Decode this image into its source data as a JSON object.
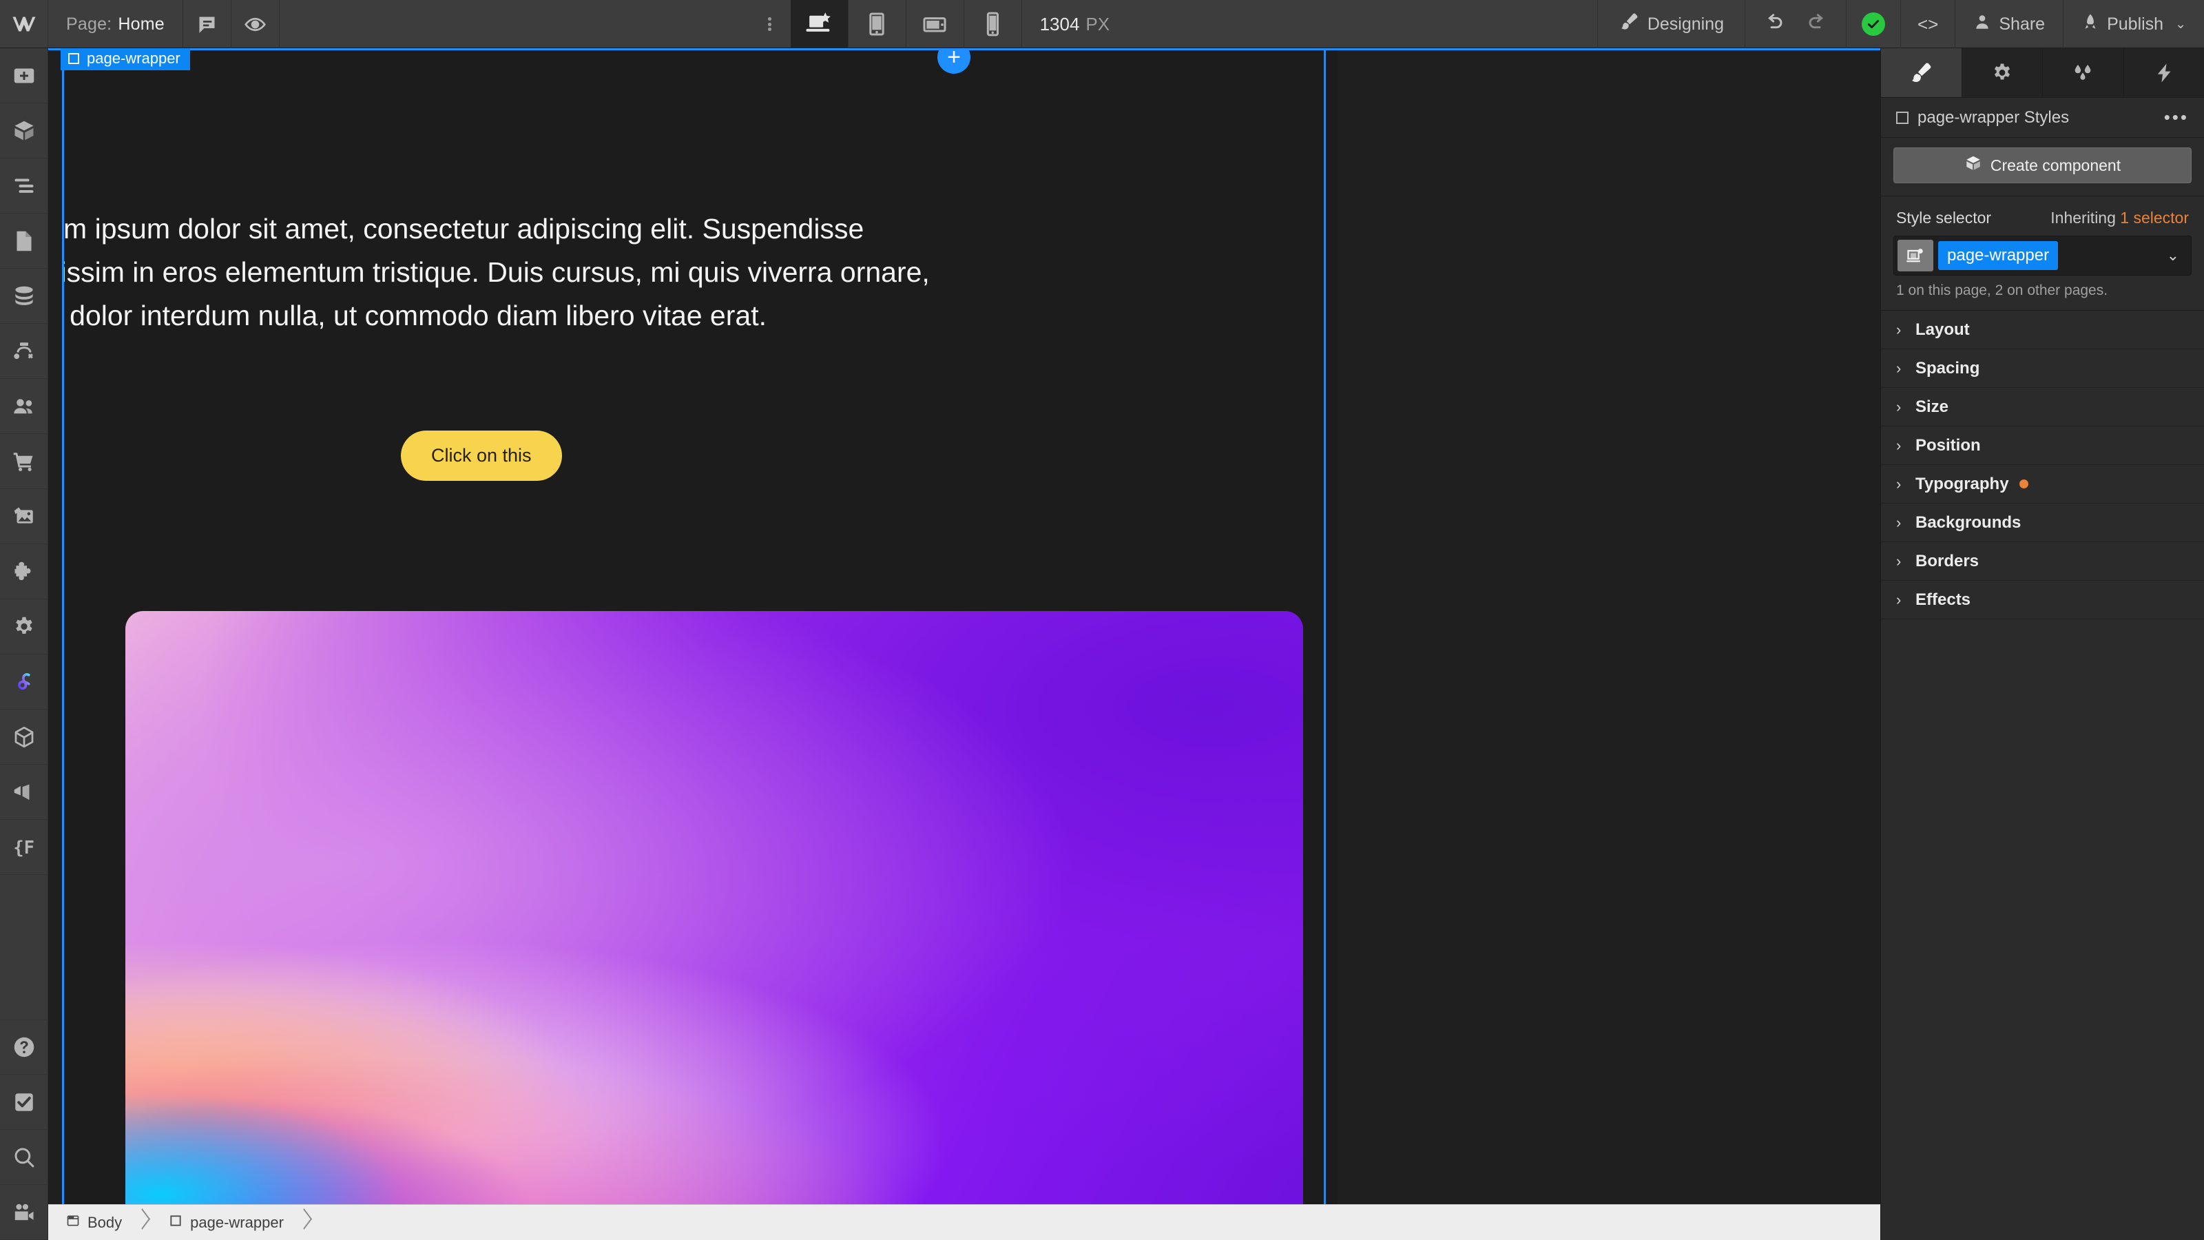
{
  "topbar": {
    "logo_icon": "webflow-logo-icon",
    "page_label": "Page:",
    "page_value": "Home",
    "comment_icon": "comment-icon",
    "preview_icon": "eye-preview-icon",
    "overflow_icon": "vertical-dots-icon",
    "devices": [
      {
        "name": "desktop-breakpoint",
        "icon": "desktop-star-icon",
        "active": true
      },
      {
        "name": "tablet-breakpoint",
        "icon": "tablet-portrait-icon",
        "active": false
      },
      {
        "name": "mobile-landscape-breakpoint",
        "icon": "tablet-landscape-icon",
        "active": false
      },
      {
        "name": "mobile-portrait-breakpoint",
        "icon": "phone-icon",
        "active": false
      }
    ],
    "viewport_width": "1304",
    "viewport_unit": "PX",
    "mode_icon": "paintbrush-icon",
    "mode_label": "Designing",
    "undo_icon": "undo-arrow-icon",
    "redo_icon": "redo-arrow-icon",
    "status_icon": "check-circle-icon",
    "code_label": "<>",
    "share_icon": "person-icon",
    "share_label": "Share",
    "publish_icon": "rocket-icon",
    "publish_label": "Publish",
    "publish_caret": "⌄"
  },
  "left_rail": {
    "items": [
      {
        "name": "add-elements-panel",
        "icon": "plus-box-icon"
      },
      {
        "name": "components-panel",
        "icon": "cube-icon"
      },
      {
        "name": "navigator-panel",
        "icon": "layers-list-icon"
      },
      {
        "name": "pages-panel",
        "icon": "page-icon"
      },
      {
        "name": "cms-panel",
        "icon": "database-icon"
      },
      {
        "name": "logic-panel",
        "icon": "logic-flow-icon"
      },
      {
        "name": "users-panel",
        "icon": "users-icon"
      },
      {
        "name": "ecommerce-panel",
        "icon": "shopping-cart-icon"
      },
      {
        "name": "assets-panel",
        "icon": "image-stack-icon"
      },
      {
        "name": "apps-panel",
        "icon": "puzzle-piece-icon"
      },
      {
        "name": "settings-panel",
        "icon": "gear-icon"
      },
      {
        "name": "interactions-panel",
        "icon": "interactions-ribbon-icon"
      },
      {
        "name": "variables-panel",
        "icon": "cube-outline-icon"
      },
      {
        "name": "audit-panel",
        "icon": "contrast-shapes-icon"
      },
      {
        "name": "code-panel",
        "icon": "curly-f-icon"
      }
    ],
    "bottom_items": [
      {
        "name": "help-button",
        "icon": "question-circle-icon"
      },
      {
        "name": "tasks-button",
        "icon": "checkbox-check-icon"
      },
      {
        "name": "search-button",
        "icon": "magnifier-icon"
      },
      {
        "name": "video-tutorials-button",
        "icon": "video-camera-icon"
      }
    ]
  },
  "canvas": {
    "selected_badge_label": "page-wrapper",
    "selected_badge_icon": "square-outline-icon",
    "add_section_button": "+",
    "hero_text": "Lorem ipsum dolor sit amet, consectetur adipiscing elit. Suspendisse dignissim in eros elementum tristique. Duis cursus, mi quis viverra ornare, eros dolor interdum nulla, ut commodo diam libero vitae erat.",
    "hero_button_label": "Click on this",
    "hero_button_color": "#F8D34E",
    "image_name": "gradient-hero-image"
  },
  "right_panel": {
    "tabs": [
      {
        "name": "tab-style",
        "icon": "paintbrush-icon",
        "active": true
      },
      {
        "name": "tab-settings",
        "icon": "gear-icon",
        "active": false
      },
      {
        "name": "tab-styles-manager",
        "icon": "water-drops-icon",
        "active": false
      },
      {
        "name": "tab-interactions",
        "icon": "lightning-bolt-icon",
        "active": false
      }
    ],
    "styles_header": "page-wrapper Styles",
    "styles_header_icon": "square-outline-icon",
    "styles_more": "•••",
    "create_component_label": "Create component",
    "create_component_icon": "cube-icon",
    "style_selector_label": "Style selector",
    "inheriting_prefix": "Inheriting ",
    "inheriting_count": "1 selector",
    "selector_chip": "page-wrapper",
    "selector_glyph_icon": "element-tag-icon",
    "selector_caret": "⌄",
    "usage_note": "1 on this page, 2 on other pages.",
    "accent_color": "#0D86F5",
    "modified_color": "#E8833A",
    "sections": [
      {
        "label": "Layout",
        "modified": false
      },
      {
        "label": "Spacing",
        "modified": false
      },
      {
        "label": "Size",
        "modified": false
      },
      {
        "label": "Position",
        "modified": false
      },
      {
        "label": "Typography",
        "modified": true
      },
      {
        "label": "Backgrounds",
        "modified": false
      },
      {
        "label": "Borders",
        "modified": false
      },
      {
        "label": "Effects",
        "modified": false
      }
    ]
  },
  "breadcrumb": {
    "items": [
      {
        "label": "Body",
        "icon": "browser-window-icon"
      },
      {
        "label": "page-wrapper",
        "icon": "square-outline-icon"
      }
    ]
  }
}
